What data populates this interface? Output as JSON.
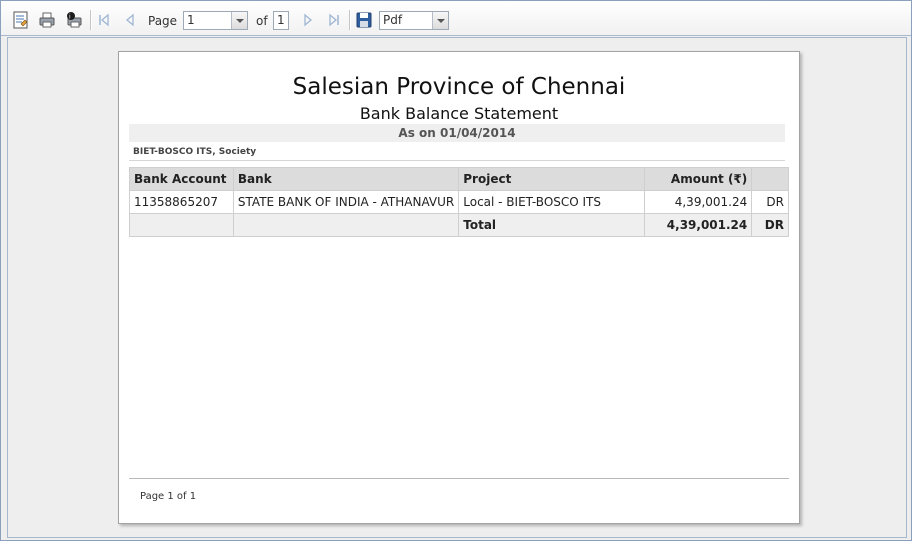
{
  "toolbar": {
    "page_label": "Page",
    "page_value": "1",
    "of_label": "of",
    "total_pages": "1",
    "export_format": "Pdf",
    "icons": [
      "document-map-icon",
      "print-icon",
      "print-preview-icon",
      "first-page-icon",
      "previous-page-icon",
      "next-page-icon",
      "last-page-icon",
      "save-icon"
    ]
  },
  "report": {
    "title": "Salesian Province of Chennai",
    "subtitle": "Bank Balance Statement",
    "as_on": "As on 01/04/2014",
    "society": "BIET-BOSCO ITS, Society",
    "columns": [
      "Bank Account",
      "Bank",
      "Project",
      "Amount (₹)",
      ""
    ],
    "rows": [
      {
        "bank_account": "11358865207",
        "bank": "STATE BANK OF INDIA - ATHANAVUR",
        "project": "Local - BIET-BOSCO ITS",
        "amount": "4,39,001.24",
        "drcr": "DR"
      }
    ],
    "total": {
      "label": "Total",
      "amount": "4,39,001.24",
      "drcr": "DR"
    },
    "footer": "Page 1 of 1"
  }
}
